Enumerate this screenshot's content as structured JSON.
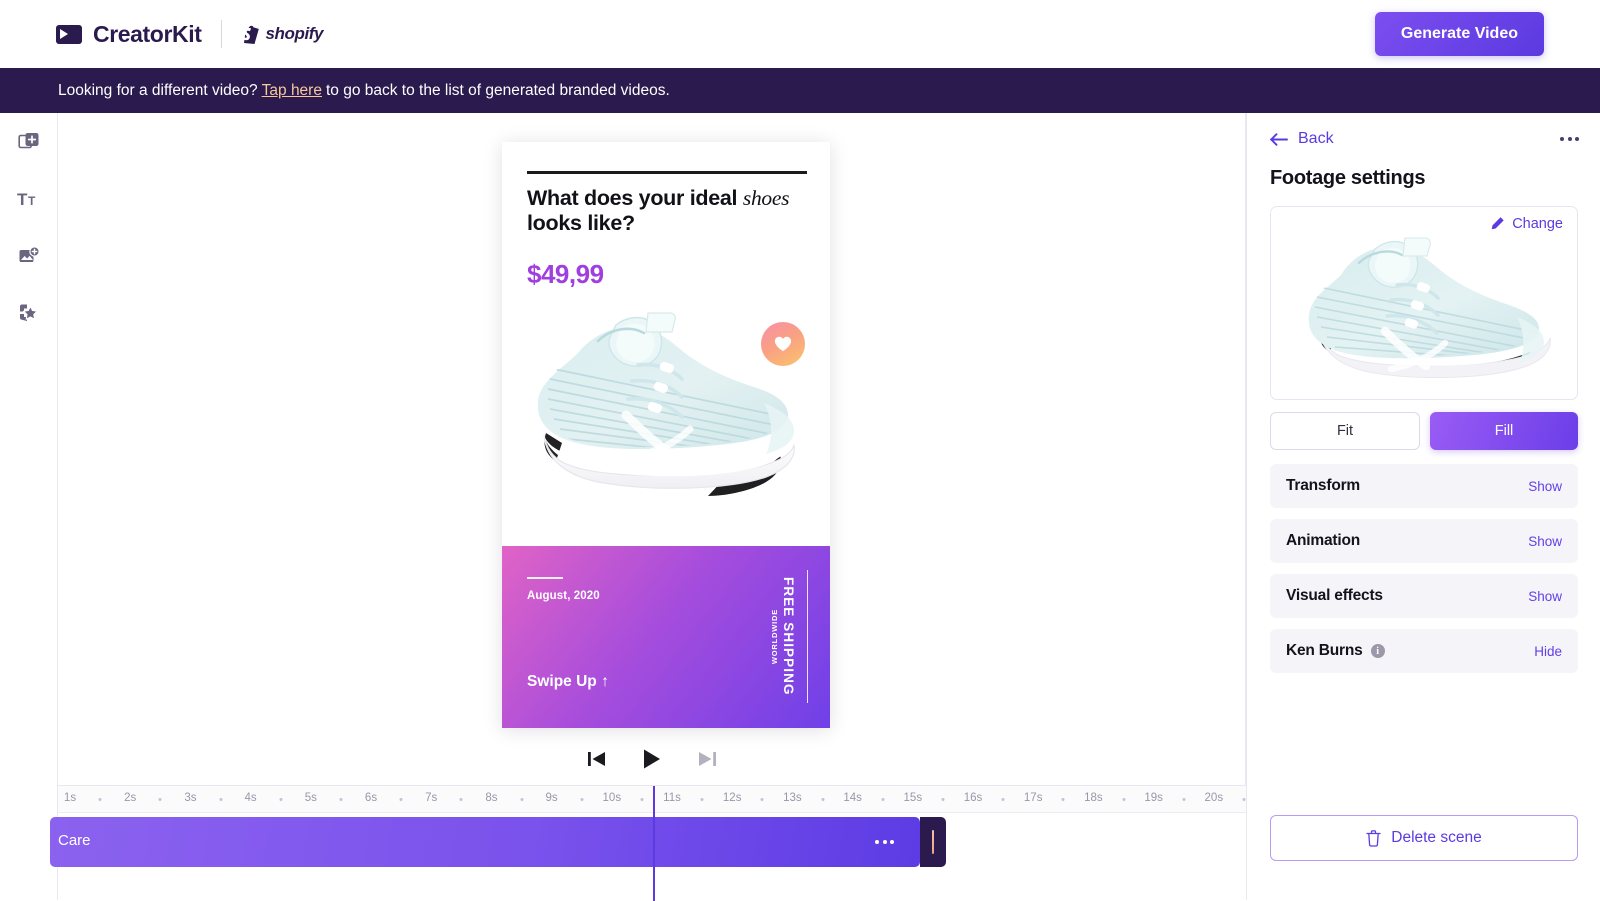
{
  "topbar": {
    "brand_name": "CreatorKit",
    "partner_name": "shopify",
    "generate_label": "Generate Video"
  },
  "banner": {
    "text_before": "Looking for a different video?",
    "link_label": "Tap here",
    "text_after": "to go back to the list of generated branded videos."
  },
  "rail": {
    "items": [
      {
        "name": "add-scene-icon",
        "title": "Add scene"
      },
      {
        "name": "text-icon",
        "title": "Text"
      },
      {
        "name": "add-image-icon",
        "title": "Add image"
      },
      {
        "name": "effects-icon",
        "title": "Effects"
      }
    ]
  },
  "preview": {
    "headline_plain": "What does your ideal ",
    "headline_italic": "shoes",
    "headline_rest": "looks like?",
    "price": "$49,99",
    "favorite_icon": "heart-icon",
    "date": "August, 2020",
    "swipe_label": "Swipe Up ↑",
    "shipping_main": "FREE SHIPPING",
    "shipping_sub": "WORLDWIDE"
  },
  "transport": {
    "skip_back": "skip-back-icon",
    "play": "play-icon",
    "skip_forward": "skip-forward-icon"
  },
  "timeline": {
    "ticks": [
      "1s",
      "2s",
      "3s",
      "4s",
      "5s",
      "6s",
      "7s",
      "8s",
      "9s",
      "10s",
      "11s",
      "12s",
      "13s",
      "14s",
      "15s",
      "16s",
      "17s",
      "18s",
      "19s",
      "20s"
    ],
    "clip_label": "Care",
    "playhead_time": "10.5s",
    "clip_start": "0s",
    "clip_end": "15s"
  },
  "panel": {
    "back_label": "Back",
    "title": "Footage settings",
    "change_label": "Change",
    "fit_label": "Fit",
    "fill_label": "Fill",
    "sections": [
      {
        "label": "Transform",
        "toggle": "Show",
        "info": false
      },
      {
        "label": "Animation",
        "toggle": "Show",
        "info": false
      },
      {
        "label": "Visual effects",
        "toggle": "Show",
        "info": false
      },
      {
        "label": "Ken Burns",
        "toggle": "Hide",
        "info": true
      }
    ],
    "delete_label": "Delete scene"
  },
  "colors": {
    "brand_dark": "#2a1a4e",
    "accent_purple": "#5b3ae0",
    "link_peach": "#f6c89a",
    "price_magenta": "#a03fe0"
  }
}
